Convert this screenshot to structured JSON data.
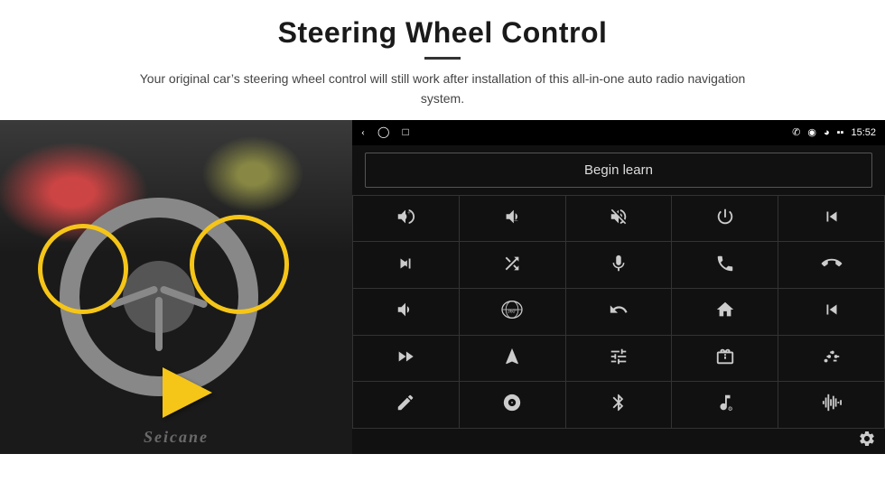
{
  "header": {
    "title": "Steering Wheel Control",
    "subtitle": "Your original car’s steering wheel control will still work after installation of this all-in-one auto radio navigation system."
  },
  "status_bar": {
    "time": "15:52",
    "nav_icons": [
      "back",
      "home",
      "square"
    ],
    "right_icons": [
      "phone",
      "location",
      "wifi",
      "signal",
      "battery"
    ]
  },
  "begin_learn_button": "Begin learn",
  "controls": [
    [
      "vol-up",
      "vol-down",
      "mute",
      "power",
      "prev-track"
    ],
    [
      "next-track",
      "fast-forward",
      "mic",
      "phone",
      "hang-up"
    ],
    [
      "speaker",
      "360-view",
      "back",
      "home-nav",
      "skip-back"
    ],
    [
      "fast-fwd2",
      "navigate",
      "tune",
      "radio",
      "equalizer"
    ],
    [
      "pen",
      "disc",
      "bluetooth",
      "music-settings",
      "waveform"
    ]
  ],
  "footer": {
    "gear_label": "Settings"
  },
  "seicane": "Seicane"
}
